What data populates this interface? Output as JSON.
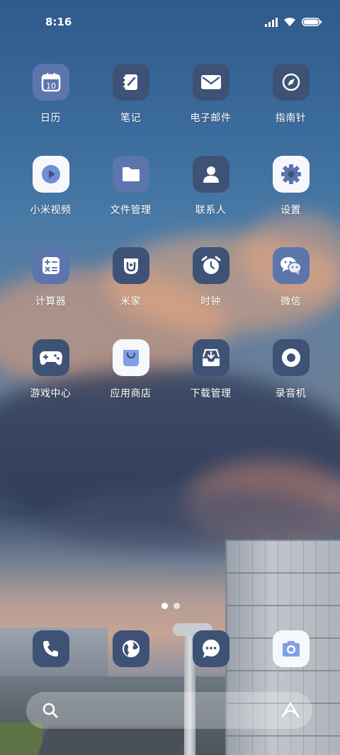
{
  "status": {
    "time": "8:16",
    "icons": [
      "signal-icon",
      "wifi-icon",
      "battery-icon"
    ]
  },
  "apps": [
    {
      "label": "日历",
      "icon": "calendar-icon",
      "badge_text": "10"
    },
    {
      "label": "笔记",
      "icon": "notes-icon"
    },
    {
      "label": "电子邮件",
      "icon": "mail-icon"
    },
    {
      "label": "指南针",
      "icon": "compass-icon"
    },
    {
      "label": "小米视频",
      "icon": "video-play-icon"
    },
    {
      "label": "文件管理",
      "icon": "folder-icon"
    },
    {
      "label": "联系人",
      "icon": "contact-person-icon"
    },
    {
      "label": "设置",
      "icon": "gear-icon"
    },
    {
      "label": "计算器",
      "icon": "calculator-icon"
    },
    {
      "label": "米家",
      "icon": "mijia-icon"
    },
    {
      "label": "时钟",
      "icon": "alarm-clock-icon"
    },
    {
      "label": "微信",
      "icon": "wechat-icon"
    },
    {
      "label": "游戏中心",
      "icon": "gamepad-icon"
    },
    {
      "label": "应用商店",
      "icon": "shopping-bag-icon"
    },
    {
      "label": "下载管理",
      "icon": "download-tray-icon"
    },
    {
      "label": "录音机",
      "icon": "record-icon"
    }
  ],
  "page_indicator": {
    "count": 2,
    "current": 1
  },
  "dock": [
    {
      "icon": "phone-icon"
    },
    {
      "icon": "browser-globe-icon"
    },
    {
      "icon": "messages-icon"
    },
    {
      "icon": "camera-icon"
    }
  ],
  "search_bar": {
    "left_icon": "search-icon",
    "right_icon": "assistant-icon"
  },
  "colors": {
    "tile_blue": "#5c75ad",
    "tile_slate": "#3d5275",
    "tile_white": "#f7f8fb",
    "accent_blue": "#4f72c9"
  }
}
